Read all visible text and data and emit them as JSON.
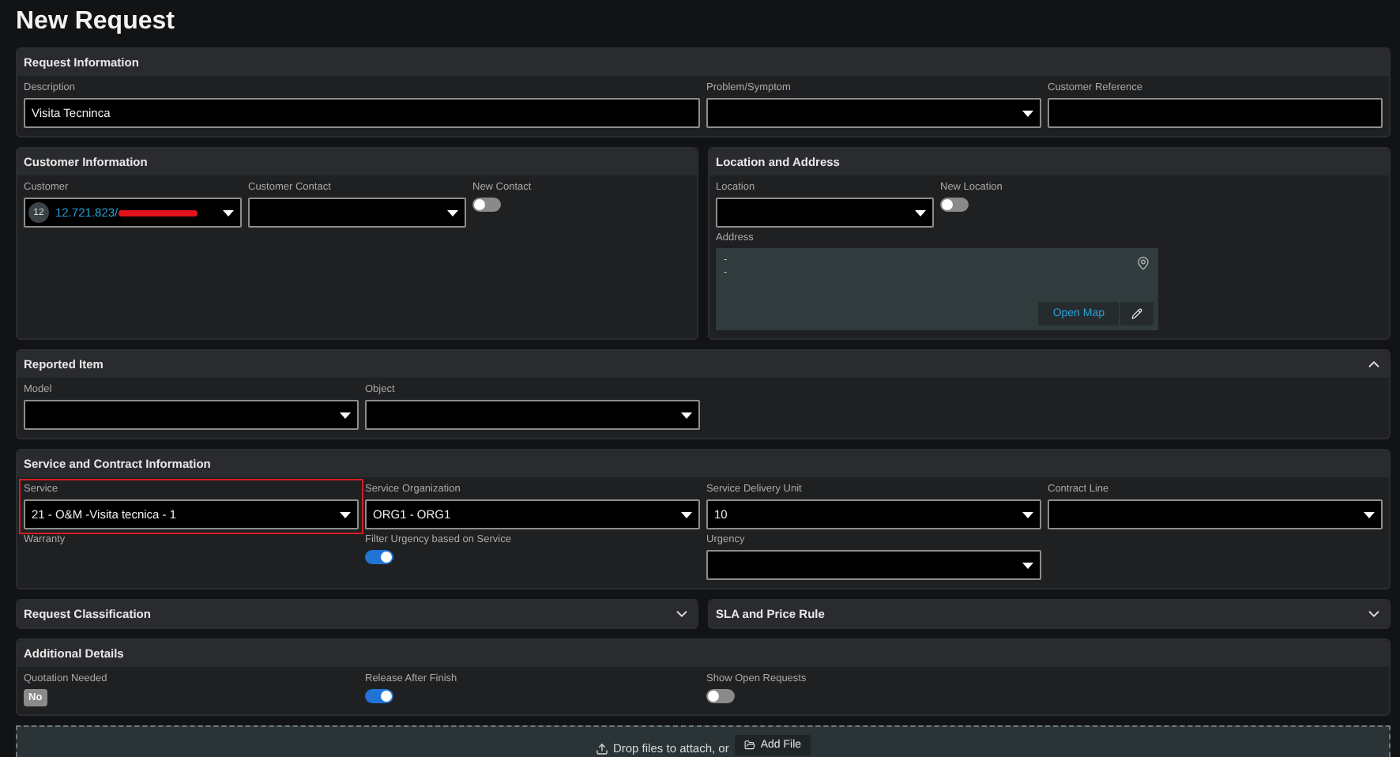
{
  "title": "New Request",
  "request_information": {
    "title": "Request Information",
    "fields": [
      {
        "kind": "text",
        "label": "Description",
        "value": "Visita Tecninca"
      },
      {
        "kind": "select",
        "label": "Problem/Symptom"
      },
      {
        "kind": "text",
        "label": "Customer Reference"
      }
    ]
  },
  "customer_information": {
    "title": "Customer Information",
    "fields": [
      {
        "kind": "customer",
        "label": "Customer",
        "badge": "12",
        "value": "12.721.823/"
      },
      {
        "kind": "select",
        "label": "Customer Contact"
      },
      {
        "kind": "toggle",
        "label": "New Contact",
        "on": false
      }
    ]
  },
  "location_and_address": {
    "title": "Location and Address",
    "fields": [
      {
        "kind": "select",
        "label": "Location"
      },
      {
        "kind": "toggle",
        "label": "New Location",
        "on": false
      },
      {
        "kind": "address",
        "label": "Address",
        "lines": [
          "-",
          "-"
        ],
        "button": "Open Map"
      }
    ]
  },
  "reported_item": {
    "title": "Reported Item",
    "expanded": true,
    "fields": [
      {
        "kind": "select",
        "label": "Model"
      },
      {
        "kind": "select",
        "label": "Object"
      }
    ]
  },
  "service_and_contract": {
    "title": "Service and Contract Information",
    "fields": [
      {
        "kind": "select",
        "label": "Service",
        "value": "21 - O&M -Visita tecnica - 1",
        "highlighted": true
      },
      {
        "kind": "select",
        "label": "Service Organization",
        "value": "ORG1 - ORG1",
        "highlighted": false
      },
      {
        "kind": "select",
        "label": "Service Delivery Unit",
        "value": "10",
        "highlighted": false
      },
      {
        "kind": "select",
        "label": "Contract Line",
        "highlighted": false
      },
      {
        "kind": "label",
        "label": "Warranty"
      },
      {
        "kind": "toggle",
        "label": "Filter Urgency based on Service",
        "on": true
      },
      {
        "kind": "select",
        "label": "Urgency",
        "highlighted": false
      }
    ]
  },
  "collapsed_sections": [
    {
      "title": "Request Classification",
      "expanded": false
    },
    {
      "title": "SLA and Price Rule",
      "expanded": false
    }
  ],
  "additional_details": {
    "title": "Additional Details",
    "fields": [
      {
        "kind": "badge",
        "label": "Quotation Needed",
        "value": "No"
      },
      {
        "kind": "toggle",
        "label": "Release After Finish",
        "on": true
      },
      {
        "kind": "toggle",
        "label": "Show Open Requests",
        "on": false
      }
    ]
  },
  "attachments": {
    "text": "Drop files to attach, or",
    "button": "Add File"
  }
}
